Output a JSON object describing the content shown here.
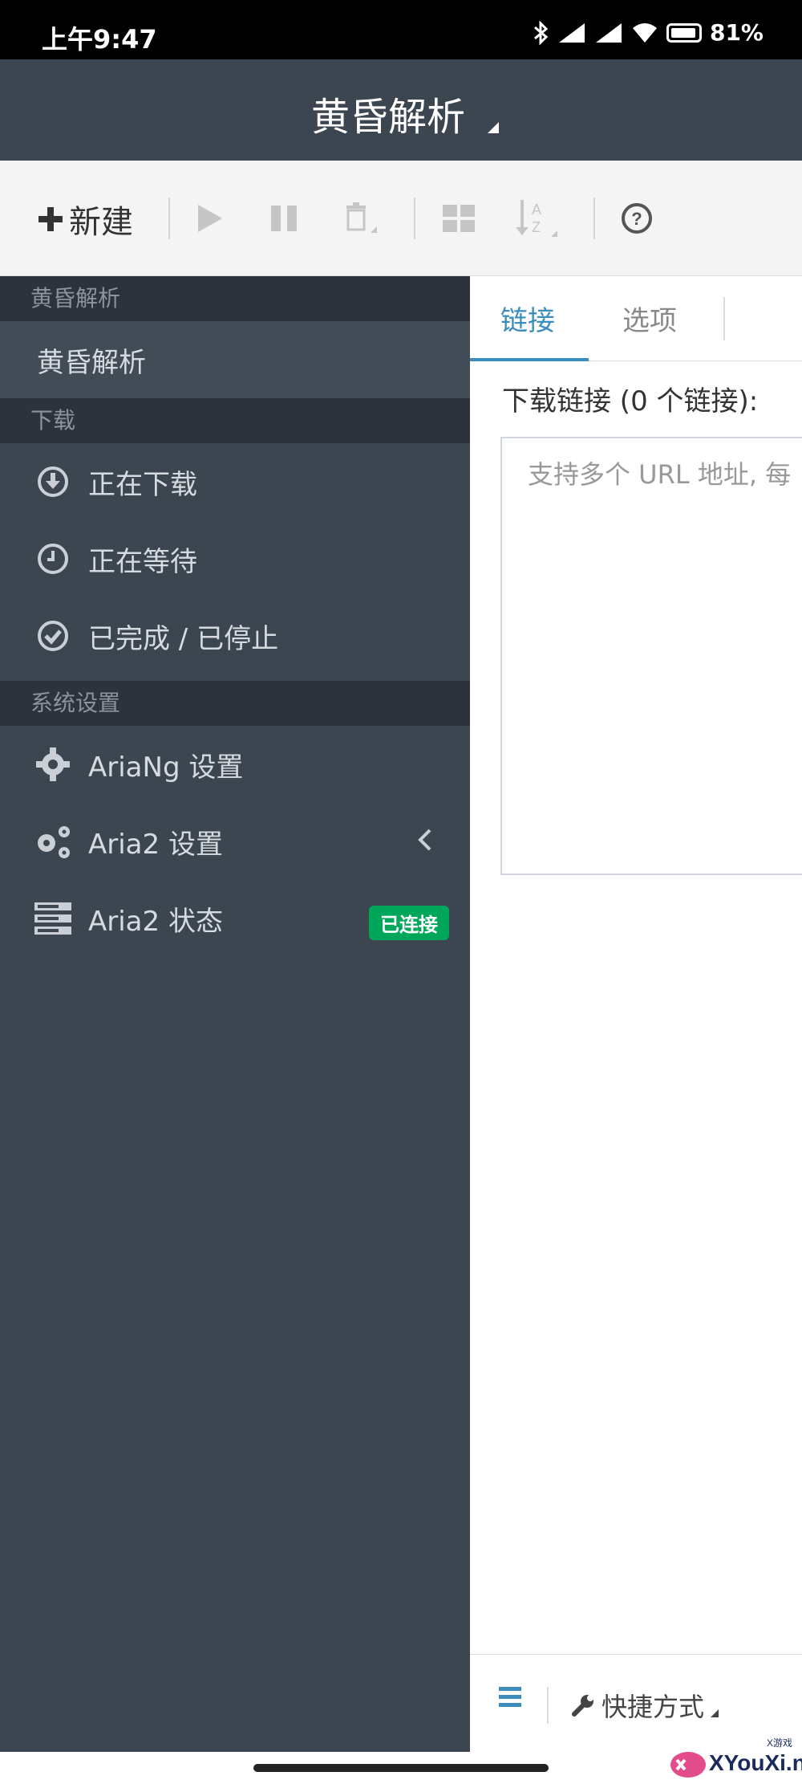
{
  "status_bar": {
    "time": "上午9:47",
    "battery": "81%"
  },
  "header": {
    "title": "黄昏解析"
  },
  "toolbar": {
    "new_label": "新建",
    "icons": [
      "plus-icon",
      "play-icon",
      "pause-icon",
      "trash-icon",
      "grid-icon",
      "sort-az-icon",
      "help-icon"
    ]
  },
  "sidebar": {
    "sections": [
      {
        "header": "黄昏解析",
        "items": [
          {
            "label": "黄昏解析"
          }
        ]
      },
      {
        "header": "下载",
        "items": [
          {
            "label": "正在下载",
            "icon": "download-circle-icon"
          },
          {
            "label": "正在等待",
            "icon": "clock-icon"
          },
          {
            "label": "已完成 / 已停止",
            "icon": "check-circle-icon"
          }
        ]
      },
      {
        "header": "系统设置",
        "items": [
          {
            "label": "AriaNg 设置",
            "icon": "gear-icon"
          },
          {
            "label": "Aria2 设置",
            "icon": "gears-icon"
          },
          {
            "label": "Aria2 状态",
            "icon": "server-icon",
            "badge": "已连接",
            "badge_color": "#00a65a"
          }
        ]
      }
    ]
  },
  "main": {
    "tabs": [
      {
        "label": "链接",
        "active": true
      },
      {
        "label": "选项",
        "active": false
      }
    ],
    "field_label": "下载链接 (0 个链接):",
    "placeholder": "支持多个 URL 地址, 每"
  },
  "footer": {
    "shortcut_label": "快捷方式"
  },
  "watermark": {
    "text": "XYouXi.net",
    "small": "X游戏"
  },
  "colors": {
    "sidebar_bg": "#3c4650",
    "section_header_bg": "#2c333a",
    "accent": "#3c8dbc",
    "badge_green": "#00a65a"
  }
}
